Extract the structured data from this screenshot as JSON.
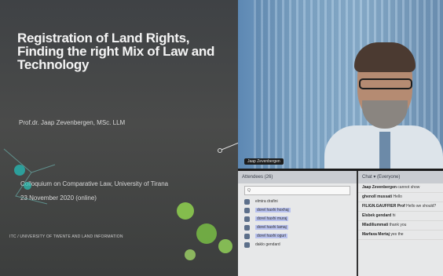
{
  "slide": {
    "title": "Registration of Land Rights,\nFinding the right Mix of Law and\nTechnology",
    "author": "Prof.dr. Jaap Zevenbergen, MSc. LLM",
    "event": "Colloquium on Comparative Law, University of Tirana",
    "date": "23 November 2020 (online)",
    "footer": "ITC / UNIVERSITY OF TWENTE AND LAND INFORMATION"
  },
  "video": {
    "presenter_name": "Jaap Zevenbergen"
  },
  "attendees_panel": {
    "title": "Attendees (26)",
    "search_placeholder": "Q",
    "items": [
      {
        "label": "elmira drafini"
      },
      {
        "label": "dorel haxhi hoxhaj"
      },
      {
        "label": "dorel haxhi muraj"
      },
      {
        "label": "dorel haxhi lamaj"
      },
      {
        "label": "dorel haxhi oguri"
      },
      {
        "label": "daklo gendard"
      }
    ]
  },
  "chat_panel": {
    "title": "Chat ▾ (Everyone)",
    "messages": [
      {
        "author": "Jaap Zevenbergen",
        "text": "cannot show"
      },
      {
        "author": "ghenoll mussati",
        "text": "Hello"
      },
      {
        "author": "FILIGN.GAUFFIER Prof",
        "text": "Hello we should?"
      },
      {
        "author": "Elsbek gendard",
        "text": "hi"
      },
      {
        "author": "Mladiliummati",
        "text": "thank you"
      },
      {
        "author": "Marfaxa Mertaj",
        "text": "yes the"
      }
    ]
  },
  "colors": {
    "slide_bg": "#45474a",
    "panel_bg": "#e7e8e9",
    "highlight": "#b9c2ef",
    "accent_green": "#8fd14f",
    "accent_teal": "#26b5b0"
  }
}
